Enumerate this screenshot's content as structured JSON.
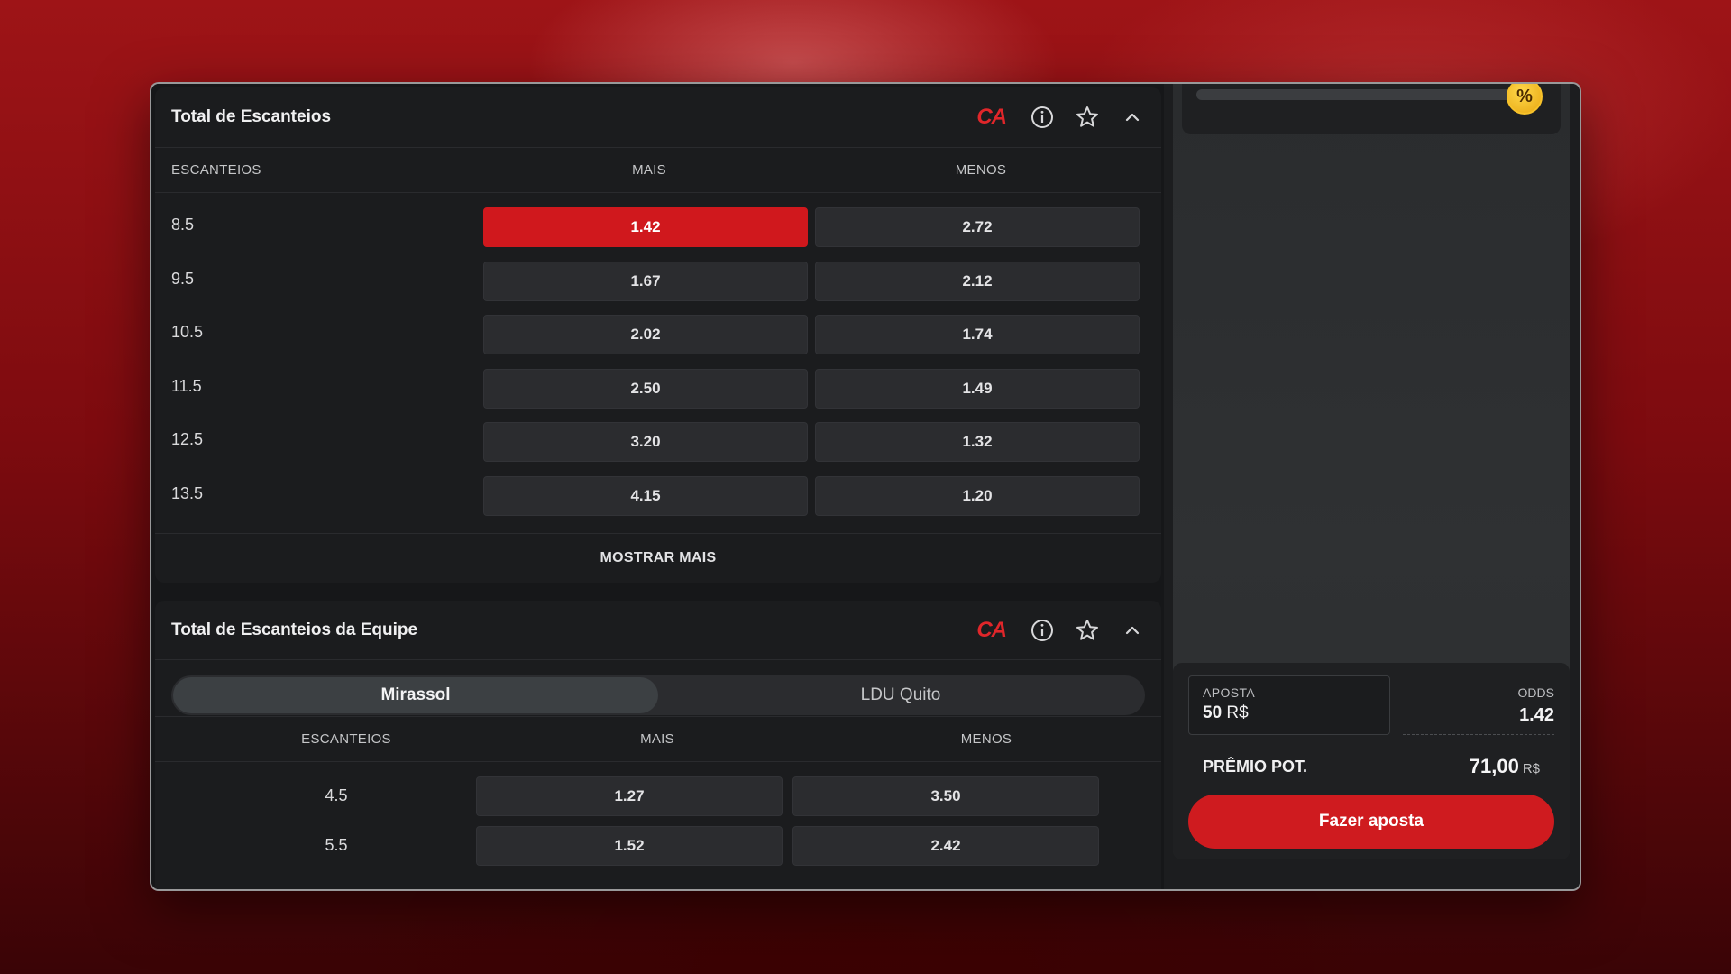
{
  "market1": {
    "title": "Total de Escanteios",
    "badge": "CA",
    "columns": {
      "label": "ESCANTEIOS",
      "over": "MAIS",
      "under": "MENOS"
    },
    "rows": [
      {
        "line": "8.5",
        "over": "1.42",
        "under": "2.72",
        "selected": "over"
      },
      {
        "line": "9.5",
        "over": "1.67",
        "under": "2.12"
      },
      {
        "line": "10.5",
        "over": "2.02",
        "under": "1.74"
      },
      {
        "line": "11.5",
        "over": "2.50",
        "under": "1.49"
      },
      {
        "line": "12.5",
        "over": "3.20",
        "under": "1.32"
      },
      {
        "line": "13.5",
        "over": "4.15",
        "under": "1.20"
      }
    ],
    "show_more": "MOSTRAR MAIS"
  },
  "market2": {
    "title": "Total de Escanteios da Equipe",
    "badge": "CA",
    "teams": [
      {
        "name": "Mirassol",
        "active": true
      },
      {
        "name": "LDU Quito",
        "active": false
      }
    ],
    "columns": {
      "label": "ESCANTEIOS",
      "over": "MAIS",
      "under": "MENOS"
    },
    "rows": [
      {
        "line": "4.5",
        "over": "1.27",
        "under": "3.50"
      },
      {
        "line": "5.5",
        "over": "1.52",
        "under": "2.42"
      }
    ]
  },
  "icons": {
    "info": "info-icon",
    "favorite": "star-icon",
    "collapse": "chevron-up-icon",
    "promo": "percent-coin-icon"
  },
  "betslip": {
    "promo_symbol": "%",
    "stake_label": "APOSTA",
    "stake_value": "50",
    "stake_currency": "R$",
    "odds_label": "ODDS",
    "odds_value": "1.42",
    "prize_label": "PRÊMIO POT.",
    "prize_value": "71,00",
    "prize_currency": "R$",
    "place_bet_label": "Fazer aposta"
  },
  "colors": {
    "accent": "#d0181d",
    "panel": "#1b1c1e",
    "odd_bg": "#2b2c2f",
    "badge": "#e0262a",
    "coin": "#f7c22a"
  }
}
